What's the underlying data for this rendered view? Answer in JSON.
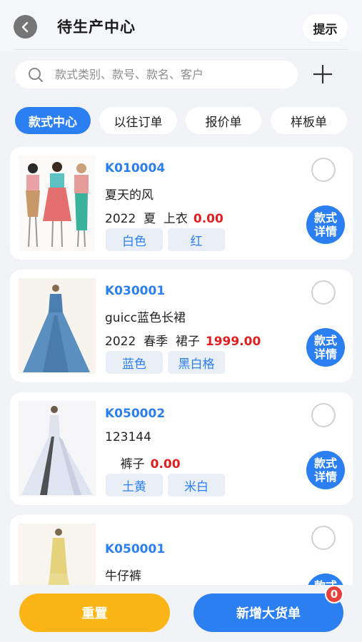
{
  "header": {
    "title": "待生产中心",
    "tip_label": "提示"
  },
  "search": {
    "placeholder": "款式类别、款号、款名、客户"
  },
  "tabs": [
    {
      "label": "款式中心",
      "active": true
    },
    {
      "label": "以往订单",
      "active": false
    },
    {
      "label": "报价单",
      "active": false
    },
    {
      "label": "样板单",
      "active": false
    }
  ],
  "items": [
    {
      "code": "K010004",
      "name": "夏天的风",
      "year": "2022",
      "season": "夏",
      "category": "上衣",
      "price": "0.00",
      "colors": [
        "白色",
        "红"
      ],
      "detail_label": "款式详情"
    },
    {
      "code": "K030001",
      "name": "guicc蓝色长裙",
      "year": "2022",
      "season": "春季",
      "category": "裙子",
      "price": "1999.00",
      "colors": [
        "蓝色",
        "黑白格"
      ],
      "detail_label": "款式详情"
    },
    {
      "code": "K050002",
      "name": "123144",
      "year": "",
      "season": "",
      "category": "裤子",
      "price": "0.00",
      "colors": [
        "土黄",
        "米白"
      ],
      "detail_label": "款式详情"
    },
    {
      "code": "K050001",
      "name": "牛仔裤",
      "detail_label": "款式详情"
    }
  ],
  "footer": {
    "reset_label": "重置",
    "add_label": "新增大货单",
    "badge_count": "0"
  },
  "colors": {
    "accent": "#2b7ff0",
    "reset": "#fbb516",
    "price": "#e02020",
    "badge": "#e8403d"
  }
}
